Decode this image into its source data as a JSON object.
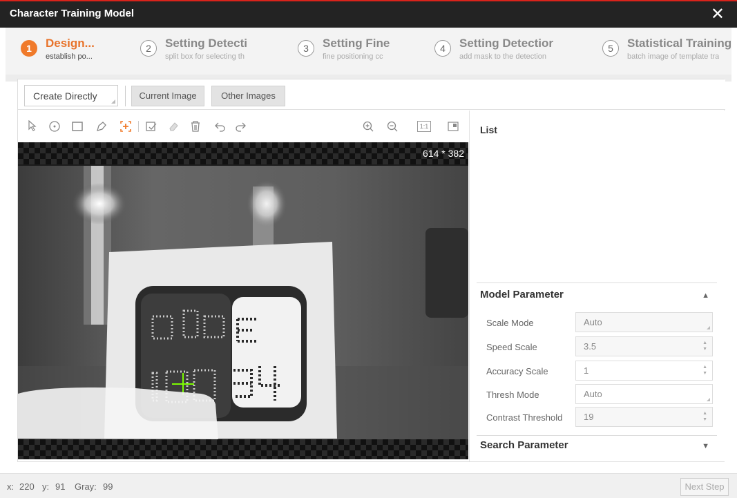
{
  "window": {
    "title": "Character Training Model",
    "close_icon": "close-icon"
  },
  "steps": [
    {
      "number": "1",
      "title": "Design...",
      "subtitle": "establish po...",
      "active": true
    },
    {
      "number": "2",
      "title": "Setting Detecti",
      "subtitle": "split box for selecting th",
      "active": false
    },
    {
      "number": "3",
      "title": "Setting Fine",
      "subtitle": "fine positioning cc",
      "active": false
    },
    {
      "number": "4",
      "title": "Setting Detectior",
      "subtitle": "add mask to the detection",
      "active": false
    },
    {
      "number": "5",
      "title": "Statistical Training",
      "subtitle": "batch image of template tra",
      "active": false
    }
  ],
  "topbar": {
    "create_mode": "Create Directly",
    "current_image": "Current Image",
    "other_images": "Other Images"
  },
  "toolbar": {
    "icons": [
      "pointer-icon",
      "circle-tool-icon",
      "rectangle-tool-icon",
      "polygon-tool-icon",
      "add-roi-icon",
      "edit-roi-icon",
      "eraser-icon",
      "delete-icon",
      "undo-icon",
      "redo-icon",
      "zoom-in-icon",
      "zoom-out-icon",
      "actual-size-icon",
      "fit-window-icon"
    ],
    "actual_size_label": "1:1"
  },
  "canvas": {
    "image_size": "614 * 382",
    "crosshair_color": "#7cfc00"
  },
  "right_panel": {
    "list_title": "List",
    "model_parameter": {
      "title": "Model Parameter",
      "rows": [
        {
          "label": "Scale Mode",
          "value": "Auto",
          "type": "select"
        },
        {
          "label": "Speed Scale",
          "value": "3.5",
          "type": "spin"
        },
        {
          "label": "Accuracy Scale",
          "value": "1",
          "type": "spin"
        },
        {
          "label": "Thresh Mode",
          "value": "Auto",
          "type": "select"
        },
        {
          "label": "Contrast Threshold",
          "value": "19",
          "type": "spin"
        }
      ]
    },
    "search_parameter": {
      "title": "Search Parameter"
    }
  },
  "status": {
    "x_label": "x:",
    "x_value": "220",
    "y_label": "y:",
    "y_value": "91",
    "gray_label": "Gray:",
    "gray_value": "99"
  },
  "footer": {
    "next_step": "Next Step"
  },
  "colors": {
    "accent": "#f07a2a",
    "titlebar": "#232323",
    "title_stripe": "#d9231b"
  }
}
